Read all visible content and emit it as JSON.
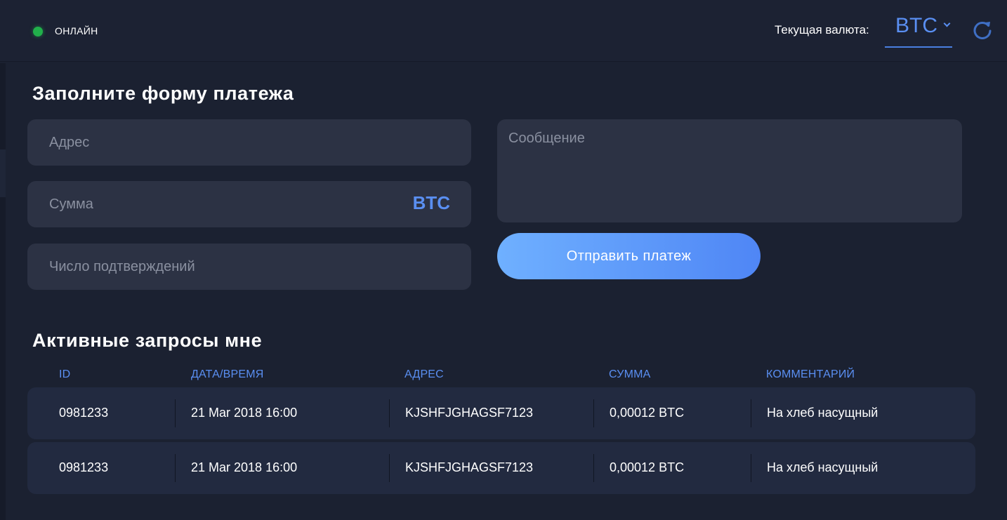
{
  "header": {
    "status_label": "ОНЛАЙН",
    "status_color": "#21b04b",
    "currency_label": "Текущая валюта:",
    "currency_value": "BTC",
    "accent_color": "#5a8ff2",
    "refresh_icon": "refresh-icon"
  },
  "payment_form": {
    "title": "Заполните форму платежа",
    "address_placeholder": "Адрес",
    "amount_placeholder": "Сумма",
    "amount_unit": "BTC",
    "confirmations_placeholder": "Число подтверждений",
    "message_placeholder": "Сообщение",
    "submit_label": "Отправить платеж"
  },
  "requests": {
    "title": "Активные запросы мне",
    "columns": {
      "id": "ID",
      "datetime": "ДАТА/ВРЕМЯ",
      "address": "АДРЕС",
      "amount": "СУММА",
      "comment": "КОММЕНТАРИЙ"
    },
    "rows": [
      {
        "id": "0981233",
        "datetime": "21 Mar 2018 16:00",
        "address": "KJSHFJGHAGSF7123",
        "amount": "0,00012 BTC",
        "comment": "На хлеб насущный"
      },
      {
        "id": "0981233",
        "datetime": "21 Mar 2018 16:00",
        "address": "KJSHFJGHAGSF7123",
        "amount": "0,00012 BTC",
        "comment": "На хлеб насущный"
      }
    ]
  }
}
